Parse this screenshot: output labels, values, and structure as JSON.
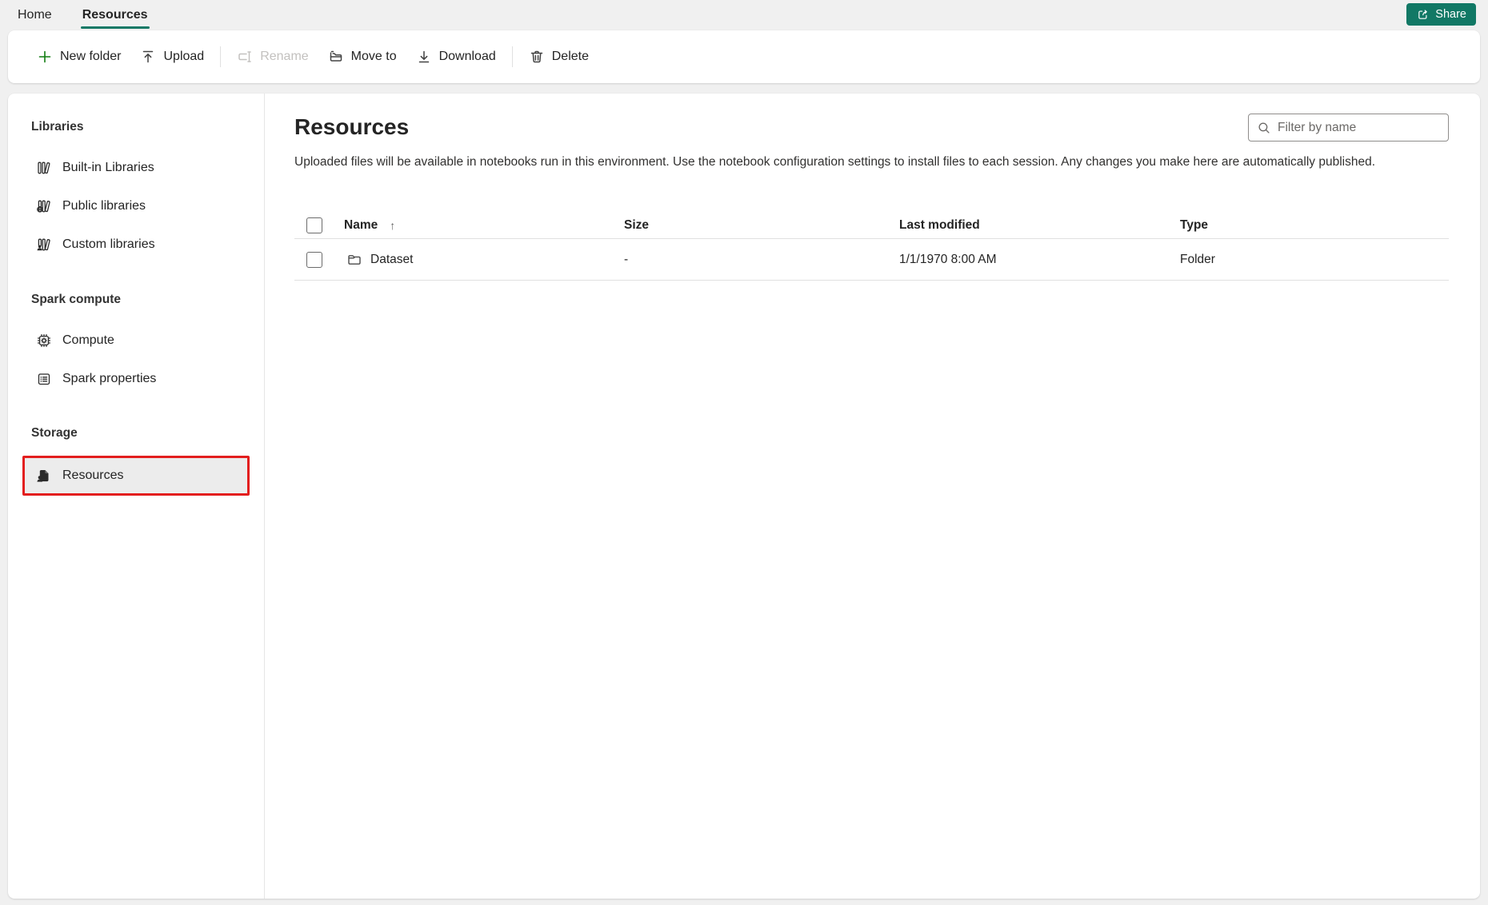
{
  "tabs": {
    "home": "Home",
    "resources": "Resources"
  },
  "share": {
    "label": "Share"
  },
  "toolbar": {
    "new_folder": "New folder",
    "upload": "Upload",
    "rename": "Rename",
    "move_to": "Move to",
    "download": "Download",
    "delete": "Delete"
  },
  "sidebar": {
    "sections": [
      {
        "title": "Libraries",
        "items": [
          {
            "label": "Built-in Libraries"
          },
          {
            "label": "Public libraries"
          },
          {
            "label": "Custom libraries"
          }
        ]
      },
      {
        "title": "Spark compute",
        "items": [
          {
            "label": "Compute"
          },
          {
            "label": "Spark properties"
          }
        ]
      },
      {
        "title": "Storage",
        "items": [
          {
            "label": "Resources",
            "selected": true
          }
        ]
      }
    ]
  },
  "main": {
    "title": "Resources",
    "description": "Uploaded files will be available in notebooks run in this environment. Use the notebook configuration settings to install files to each session. Any changes you make here are automatically published.",
    "filter_placeholder": "Filter by name"
  },
  "table": {
    "columns": {
      "name": "Name",
      "size": "Size",
      "last_modified": "Last modified",
      "type": "Type"
    },
    "sort": {
      "column": "Name",
      "direction": "asc",
      "glyph": "↑"
    },
    "rows": [
      {
        "name": "Dataset",
        "size": "-",
        "last_modified": "1/1/1970 8:00 AM",
        "type": "Folder",
        "icon": "folder-icon"
      }
    ]
  },
  "colors": {
    "accent_teal": "#117865",
    "new_folder_green": "#107c10",
    "annotation_red": "#e31e1e",
    "selected_item_bg": "#ececec"
  }
}
